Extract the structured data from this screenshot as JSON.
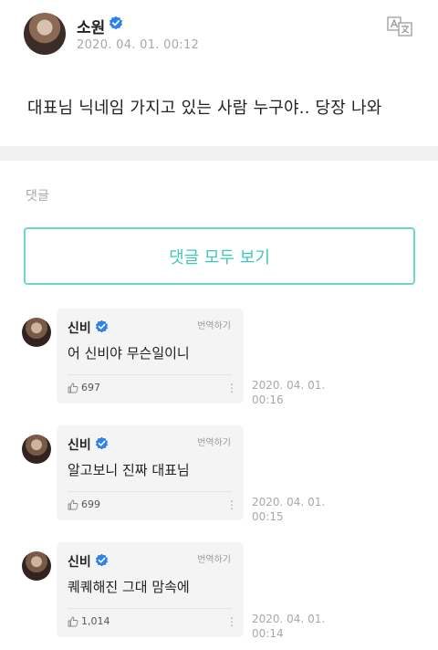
{
  "post": {
    "author": "소원",
    "date": "2020. 04. 01. 00:12",
    "body": "대표님 닉네임 가지고 있는 사람 누구야.. 당장 나와"
  },
  "colors": {
    "accent": "#3ec8bc",
    "verified": "#2e7ff0"
  },
  "comments_section": {
    "label": "댓글",
    "view_all": "댓글 모두 보기"
  },
  "comments": [
    {
      "name": "신비",
      "translate": "번역하기",
      "text": "어 신비야 무슨일이니",
      "likes": "697",
      "time_date": "2020. 04. 01.",
      "time_clock": "00:16"
    },
    {
      "name": "신비",
      "translate": "번역하기",
      "text": "알고보니 진짜 대표님",
      "likes": "699",
      "time_date": "2020. 04. 01.",
      "time_clock": "00:15"
    },
    {
      "name": "신비",
      "translate": "번역하기",
      "text": "퀘퀘해진 그대 맘속에",
      "likes": "1,014",
      "time_date": "2020. 04. 01.",
      "time_clock": "00:14"
    }
  ]
}
